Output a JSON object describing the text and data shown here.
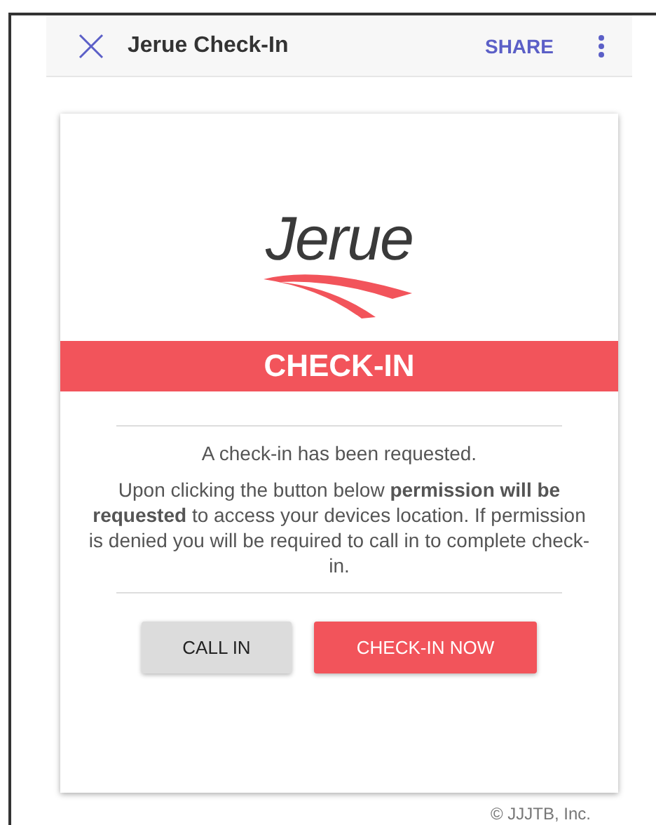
{
  "toolbar": {
    "title": "Jerue Check-In",
    "action": "SHARE"
  },
  "card": {
    "logo_text": "Jerue",
    "banner": "CHECK-IN",
    "intro": "A check-in has been requested.",
    "message": "Upon clicking the button below **permission will be requested** to access your devices location. If permission is denied you will be required to call in to complete check-in.",
    "buttons": [
      {
        "label": "CALL IN",
        "kind": "secondary"
      },
      {
        "label": "CHECK-IN NOW",
        "kind": "primary"
      }
    ]
  },
  "footer": "© JJJTB, Inc."
}
